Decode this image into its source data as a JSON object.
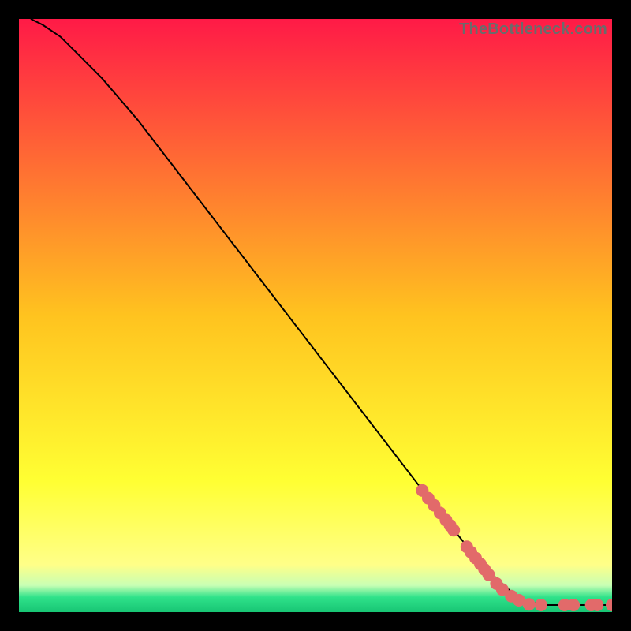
{
  "watermark": "TheBottleneck.com",
  "chart_data": {
    "type": "line",
    "title": "",
    "xlabel": "",
    "ylabel": "",
    "xlim": [
      0,
      100
    ],
    "ylim": [
      0,
      100
    ],
    "background_gradient": {
      "stops": [
        {
          "offset": 0.0,
          "color": "#ff1a47"
        },
        {
          "offset": 0.5,
          "color": "#ffc31f"
        },
        {
          "offset": 0.78,
          "color": "#ffff33"
        },
        {
          "offset": 0.92,
          "color": "#ffff88"
        },
        {
          "offset": 0.955,
          "color": "#c8ffb4"
        },
        {
          "offset": 0.975,
          "color": "#2fe28a"
        },
        {
          "offset": 1.0,
          "color": "#18c574"
        }
      ]
    },
    "curve": [
      {
        "x": 2,
        "y": 100
      },
      {
        "x": 4,
        "y": 99
      },
      {
        "x": 7,
        "y": 97
      },
      {
        "x": 10,
        "y": 94
      },
      {
        "x": 14,
        "y": 90
      },
      {
        "x": 20,
        "y": 83
      },
      {
        "x": 30,
        "y": 70
      },
      {
        "x": 40,
        "y": 57
      },
      {
        "x": 50,
        "y": 44
      },
      {
        "x": 60,
        "y": 31
      },
      {
        "x": 70,
        "y": 18
      },
      {
        "x": 78,
        "y": 8
      },
      {
        "x": 84,
        "y": 2.5
      },
      {
        "x": 88,
        "y": 1.2
      },
      {
        "x": 92,
        "y": 1.2
      },
      {
        "x": 96,
        "y": 1.2
      },
      {
        "x": 100,
        "y": 1.2
      }
    ],
    "markers": [
      {
        "x": 68,
        "y": 20.5
      },
      {
        "x": 69,
        "y": 19.2
      },
      {
        "x": 70,
        "y": 18.0
      },
      {
        "x": 71,
        "y": 16.7
      },
      {
        "x": 72,
        "y": 15.5
      },
      {
        "x": 72.7,
        "y": 14.6
      },
      {
        "x": 73.3,
        "y": 13.8
      },
      {
        "x": 75.5,
        "y": 11.0
      },
      {
        "x": 76.2,
        "y": 10.1
      },
      {
        "x": 77,
        "y": 9.1
      },
      {
        "x": 77.8,
        "y": 8.1
      },
      {
        "x": 78.5,
        "y": 7.2
      },
      {
        "x": 79.2,
        "y": 6.3
      },
      {
        "x": 80.5,
        "y": 4.8
      },
      {
        "x": 81.5,
        "y": 3.8
      },
      {
        "x": 83,
        "y": 2.7
      },
      {
        "x": 84.3,
        "y": 2.0
      },
      {
        "x": 86,
        "y": 1.3
      },
      {
        "x": 88,
        "y": 1.2
      },
      {
        "x": 92,
        "y": 1.2
      },
      {
        "x": 93.5,
        "y": 1.2
      },
      {
        "x": 96.5,
        "y": 1.2
      },
      {
        "x": 97.5,
        "y": 1.2
      },
      {
        "x": 100,
        "y": 1.2
      }
    ],
    "marker_color": "#e26a6a",
    "marker_radius": 8
  }
}
